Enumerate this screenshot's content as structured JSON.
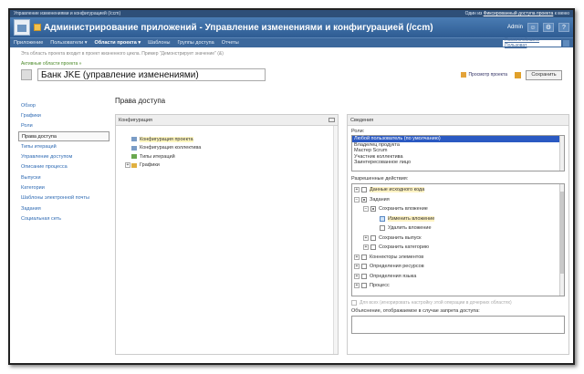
{
  "window": {
    "title": "Управление изменениями и конфигурацией (/ccm)",
    "user_text": "Один из",
    "access_link": "Фиксированный доступа проекта",
    "access_suffix": "к меню"
  },
  "banner": {
    "title": "Администрирование приложений - Управление изменениями и конфигурацией (/ccm)",
    "user": "Admin",
    "help": "?"
  },
  "nav": {
    "items": [
      "Приложение",
      "Пользователи ▾",
      "Области проекта ▾",
      "Шаблоны",
      "Группы доступа",
      "Отчеты"
    ],
    "active_index": 2,
    "search_placeholder": "Поиск в области Пользоват"
  },
  "notice": "Эта область проекта входит в проект жизненного цикла. Пример \"Демонстрирует значение\" (&)",
  "breadcrumb": "Активные области проекта »",
  "project": {
    "name": "Банк JKE (управление изменениями)",
    "preview_label": "Просмотр проекта",
    "save_label": "Сохранить"
  },
  "left_nav": {
    "items": [
      "Обзор",
      "Графики",
      "Роли",
      "Права доступа",
      "Типы итераций",
      "Управление доступом",
      "Описание процесса",
      "Выпуски",
      "Категории",
      "Шаблоны электронной почты",
      "Задания",
      "Социальная сеть"
    ],
    "selected_index": 3
  },
  "page_title": "Права доступа",
  "config_panel": {
    "header": "Конфигурация",
    "tree": [
      "Конфигурация проекта",
      "Конфигурация коллектива",
      "Типы итераций",
      "Графики"
    ]
  },
  "details_panel": {
    "header": "Сведения",
    "roles_label": "Роли:",
    "roles": [
      "Любой пользователь (по умолчанию)",
      "Владелец продукта",
      "Мастер Scrum",
      "Участник коллектива",
      "Заинтересованное лицо"
    ],
    "roles_selected": 0,
    "permissions_label": "Разрешенные действия:",
    "permissions": [
      "Данные исходного кода",
      "Задания",
      "Сохранить вложение",
      "Изменить вложение",
      "Удалить вложение",
      "Сохранить выпуск",
      "Сохранить категорию",
      "Коннекторы элементов",
      "Определения ресурсов",
      "Определения языка",
      "Процесс"
    ],
    "inherit_label": "Для всех (игнорировать настройку этой операции в дочерних областях)",
    "reason_label": "Объяснение, отображаемое в случае запрета доступа:"
  }
}
